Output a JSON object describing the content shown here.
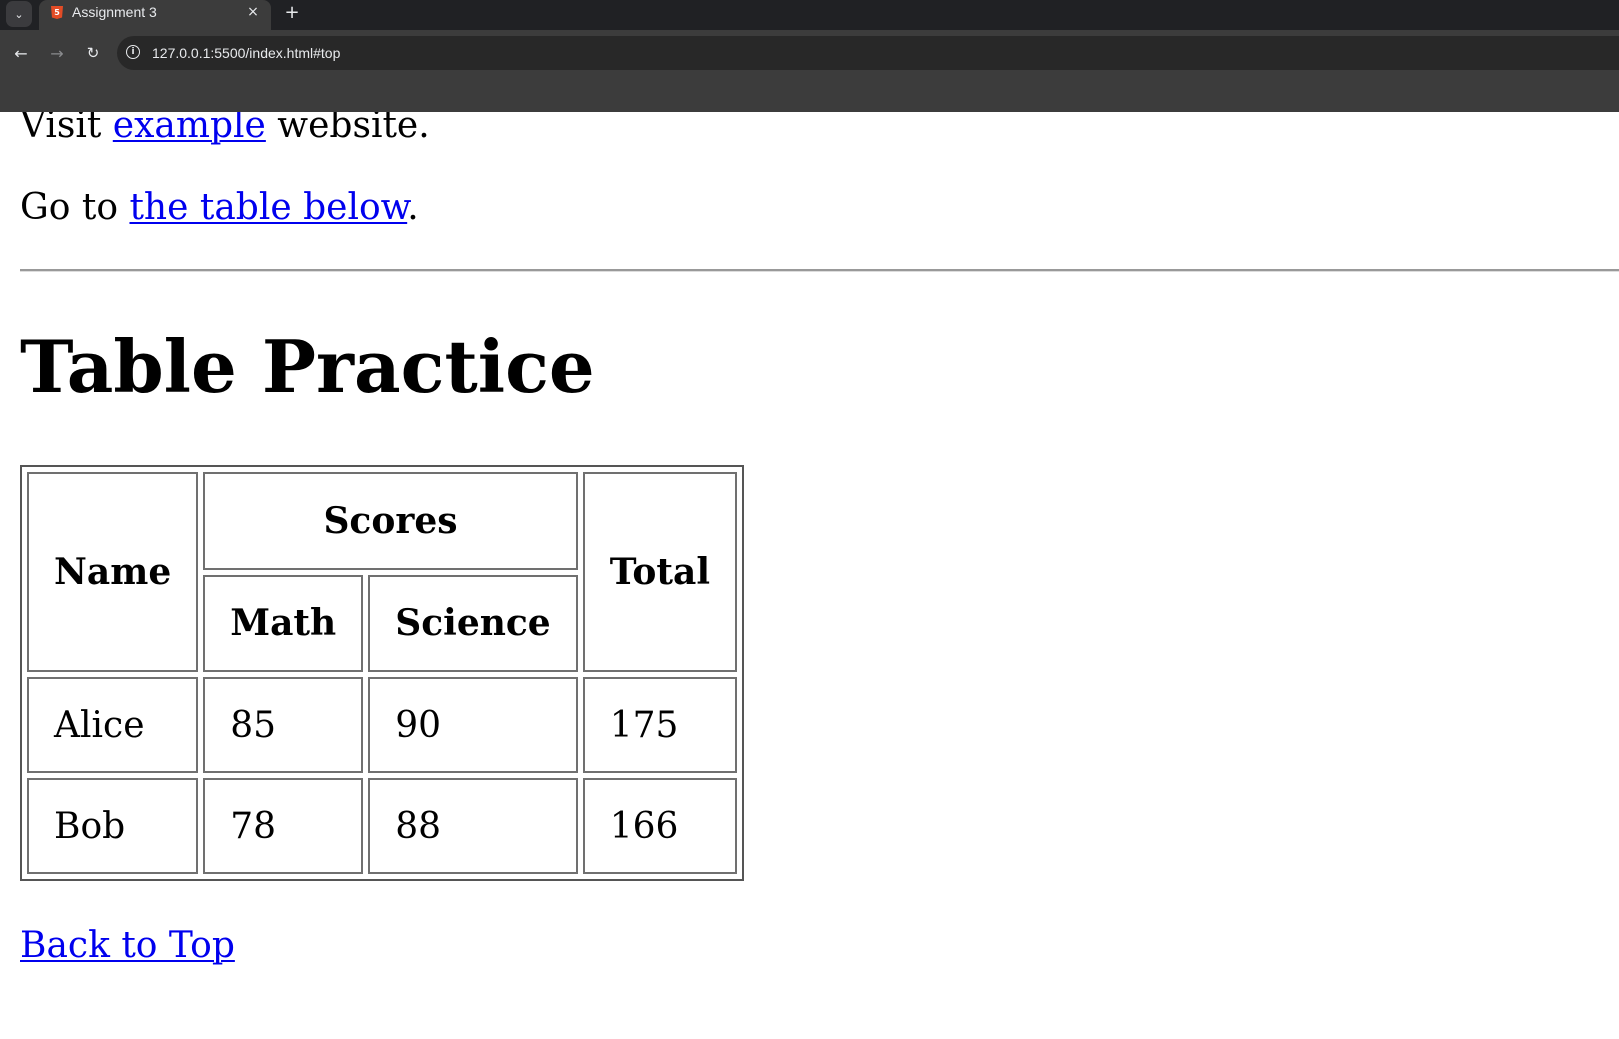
{
  "browser": {
    "tab_title": "Assignment 3",
    "tab_close": "×",
    "new_tab": "+",
    "url": "127.0.0.1:5500/index.html#top",
    "tab_search_icon": "chevron-down-icon",
    "favicon_icon": "html5-icon",
    "favicon_label": "5",
    "back_icon": "←",
    "forward_icon": "→",
    "reload_icon": "↻",
    "info_icon": "i"
  },
  "page": {
    "visit_prefix": "Visit ",
    "visit_link": "example",
    "visit_suffix": " website.",
    "goto_prefix": "Go to ",
    "goto_link": "the table below",
    "goto_suffix": ".",
    "heading": "Table Practice",
    "table": {
      "headers": {
        "name": "Name",
        "scores": "Scores",
        "total": "Total",
        "math": "Math",
        "science": "Science"
      },
      "rows": [
        {
          "name": "Alice",
          "math": "85",
          "science": "90",
          "total": "175"
        },
        {
          "name": "Bob",
          "math": "78",
          "science": "88",
          "total": "166"
        }
      ]
    },
    "back_to_top": "Back to Top"
  },
  "colors": {
    "link": "#0000ee",
    "chrome_dark": "#202124",
    "chrome": "#3c3c3c",
    "html5_orange": "#e34c26"
  }
}
